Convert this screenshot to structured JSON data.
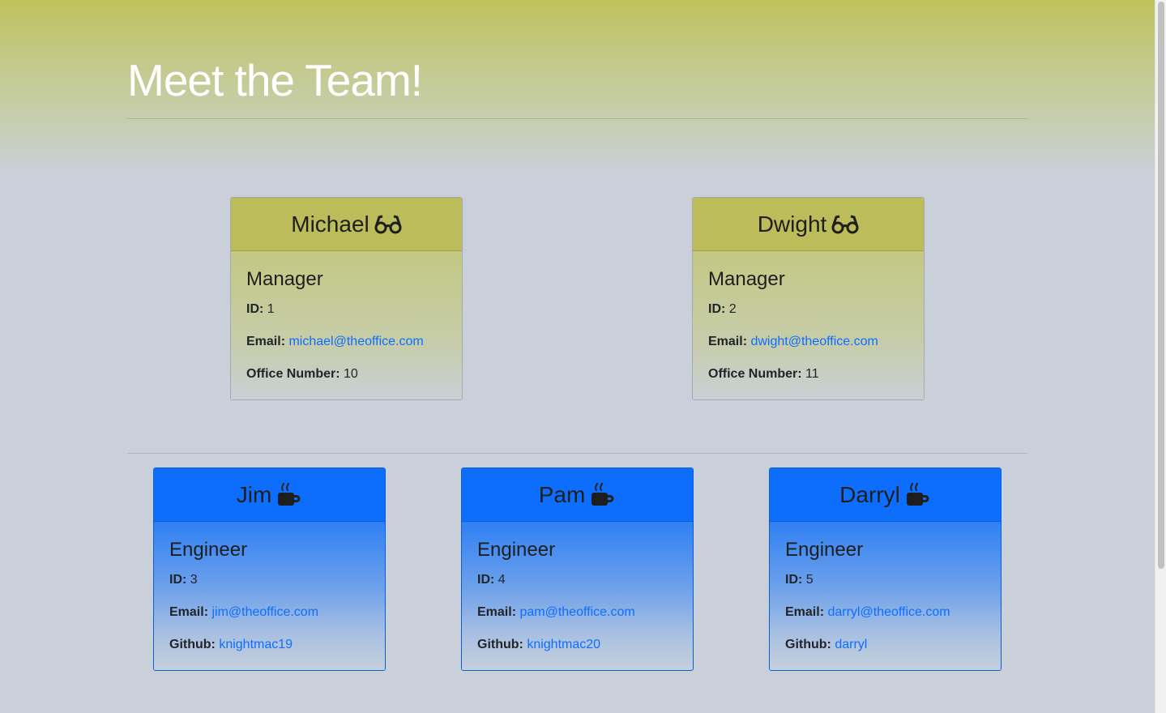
{
  "header": {
    "title": "Meet the Team!"
  },
  "managers": [
    {
      "name": "Michael",
      "icon": "glasses-icon",
      "role": "Manager",
      "id_label": "ID:",
      "id": "1",
      "email_label": "Email:",
      "email": "michael@theoffice.com",
      "extra_label": "Office Number:",
      "extra": "10"
    },
    {
      "name": "Dwight",
      "icon": "glasses-icon",
      "role": "Manager",
      "id_label": "ID:",
      "id": "2",
      "email_label": "Email:",
      "email": "dwight@theoffice.com",
      "extra_label": "Office Number:",
      "extra": "11"
    }
  ],
  "engineers": [
    {
      "name": "Jim",
      "icon": "mug-icon",
      "role": "Engineer",
      "id_label": "ID:",
      "id": "3",
      "email_label": "Email:",
      "email": "jim@theoffice.com",
      "extra_label": "Github:",
      "extra": "knightmac19"
    },
    {
      "name": "Pam",
      "icon": "mug-icon",
      "role": "Engineer",
      "id_label": "ID:",
      "id": "4",
      "email_label": "Email:",
      "email": "pam@theoffice.com",
      "extra_label": "Github:",
      "extra": "knightmac20"
    },
    {
      "name": "Darryl",
      "icon": "mug-icon",
      "role": "Engineer",
      "id_label": "ID:",
      "id": "5",
      "email_label": "Email:",
      "email": "darryl@theoffice.com",
      "extra_label": "Github:",
      "extra": "darryl"
    }
  ],
  "colors": {
    "manager_header": "#bcbd5a",
    "engineer_header": "#0d6efd",
    "link": "#0d6efd"
  }
}
